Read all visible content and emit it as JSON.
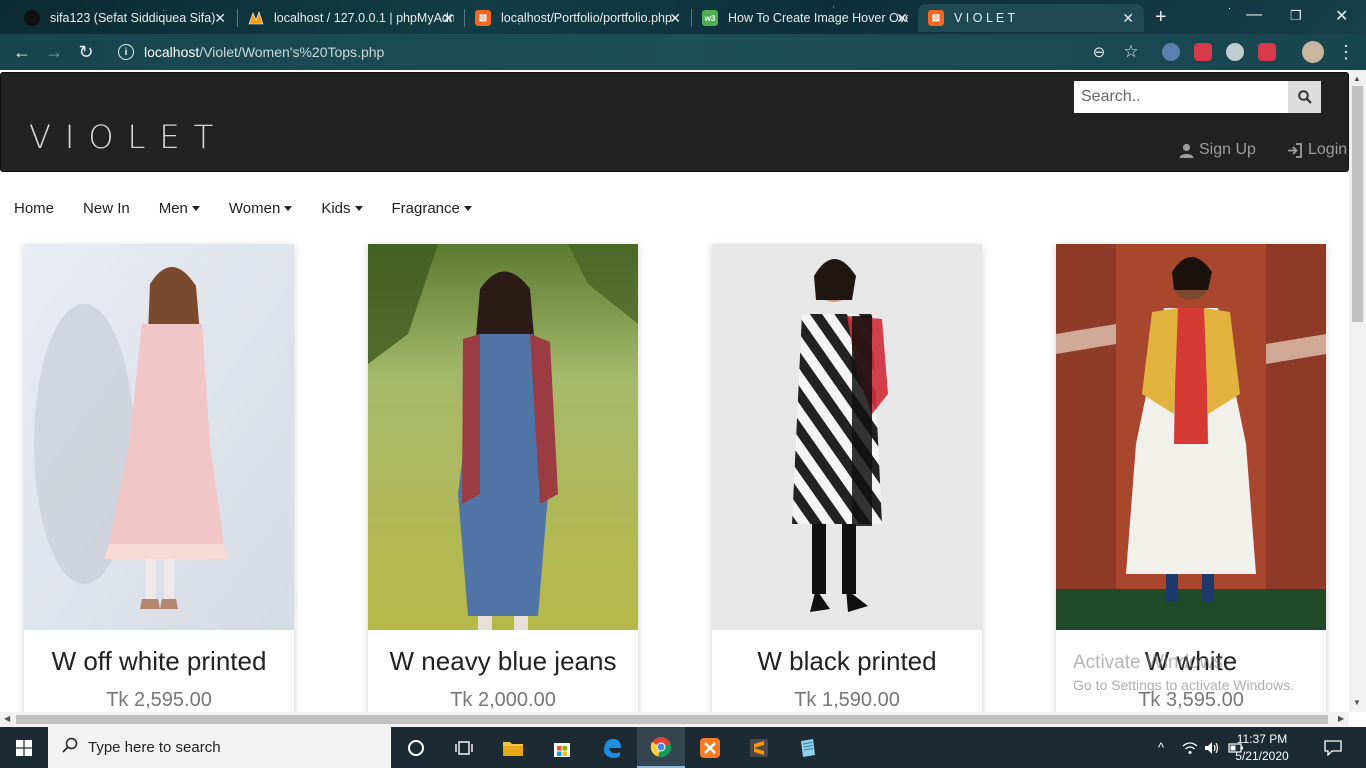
{
  "browser": {
    "tabs": [
      {
        "title": "sifa123 (Sefat Siddiquea Sifa)",
        "favicon": "github-icon"
      },
      {
        "title": "localhost / 127.0.0.1 | phpMyAdmin",
        "favicon": "phpmyadmin-icon"
      },
      {
        "title": "localhost/Portfolio/portfolio.php",
        "favicon": "xampp-icon"
      },
      {
        "title": "How To Create Image Hover Overlay",
        "favicon": "w3schools-icon"
      },
      {
        "title": "V I O L E T",
        "favicon": "xampp-icon"
      }
    ],
    "active_tab": 4,
    "url_host": "localhost",
    "url_path": "/Violet/Women's%20Tops.php"
  },
  "site": {
    "brand": "VIOLET",
    "search_placeholder": "Search..",
    "signup_label": "Sign Up",
    "login_label": "Login",
    "menu": [
      {
        "label": "Home",
        "dropdown": false
      },
      {
        "label": "New In",
        "dropdown": false
      },
      {
        "label": "Men",
        "dropdown": true
      },
      {
        "label": "Women",
        "dropdown": true
      },
      {
        "label": "Kids",
        "dropdown": true
      },
      {
        "label": "Fragrance",
        "dropdown": true
      }
    ],
    "products": [
      {
        "name": "W off white printed",
        "price": "Tk 2,595.00"
      },
      {
        "name": "W neavy blue jeans",
        "price": "Tk 2,000.00"
      },
      {
        "name": "W black printed",
        "price": "Tk 1,590.00"
      },
      {
        "name": "W white",
        "price": "Tk 3,595.00"
      }
    ]
  },
  "watermark": {
    "line1": "Activate Windows",
    "line2": "Go to Settings to activate Windows."
  },
  "taskbar": {
    "search_placeholder": "Type here to search",
    "time": "11:37 PM",
    "date": "5/21/2020"
  }
}
